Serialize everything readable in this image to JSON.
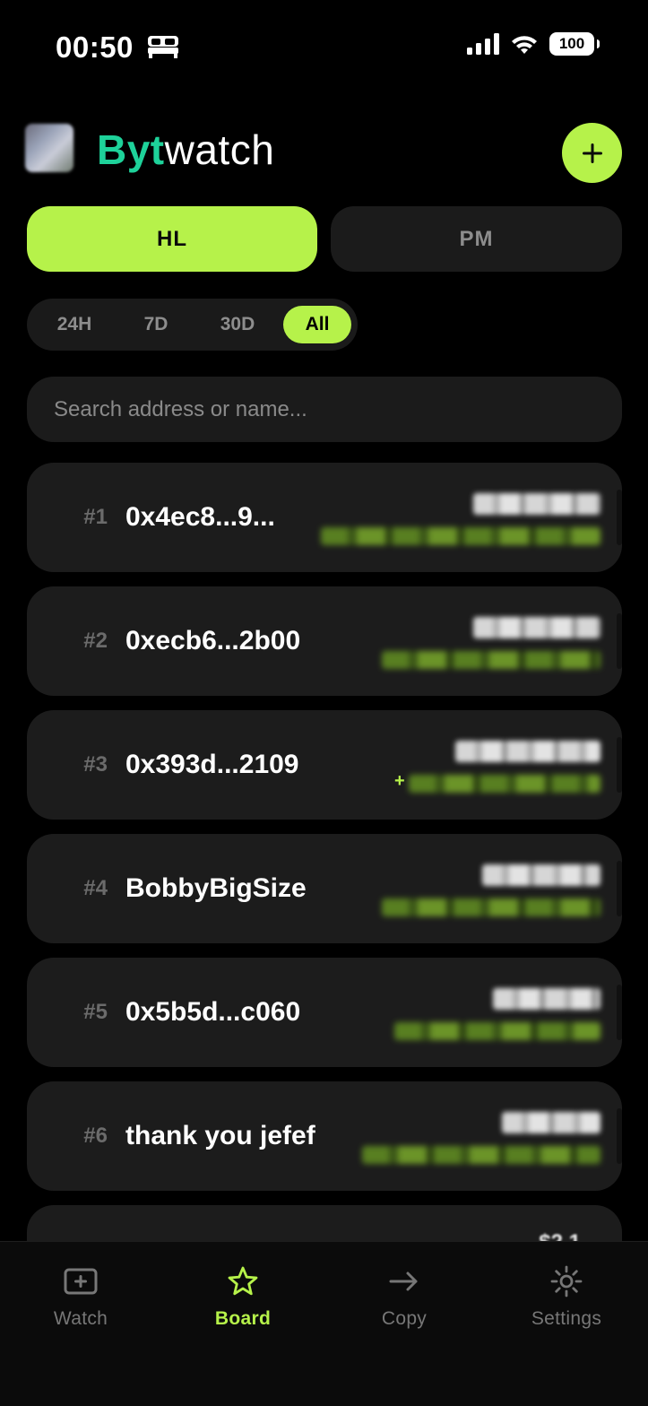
{
  "status_bar": {
    "time": "00:50",
    "battery": "100"
  },
  "header": {
    "brand_part1": "Byt",
    "brand_part2": "watch",
    "add_label": "+"
  },
  "segments": [
    {
      "label": "HL",
      "selected": true
    },
    {
      "label": "PM",
      "selected": false
    }
  ],
  "ranges": [
    {
      "label": "24H"
    },
    {
      "label": "7D"
    },
    {
      "label": "30D"
    },
    {
      "label": "All",
      "selected": true
    }
  ],
  "search": {
    "placeholder": "Search address or name..."
  },
  "leaderboard": [
    {
      "rank": "#1",
      "name": "0x4ec8...9..."
    },
    {
      "rank": "#2",
      "name": "0xecb6...2b00"
    },
    {
      "rank": "#3",
      "name": "0x393d...2109",
      "change_sign": "+"
    },
    {
      "rank": "#4",
      "name": "BobbyBigSize"
    },
    {
      "rank": "#5",
      "name": "0x5b5d...c060"
    },
    {
      "rank": "#6",
      "name": "thank you jefef"
    },
    {
      "rank": "",
      "name": "",
      "value_peek": "$2.1"
    }
  ],
  "tabbar": [
    {
      "label": "Watch",
      "icon": "plus-square-icon",
      "active": false
    },
    {
      "label": "Board",
      "icon": "star-icon",
      "active": true
    },
    {
      "label": "Copy",
      "icon": "arrow-right-icon",
      "active": false
    },
    {
      "label": "Settings",
      "icon": "gear-icon",
      "active": false
    }
  ],
  "colors": {
    "accent": "#b6f24a",
    "brand": "#1ed29a",
    "background": "#000000",
    "card": "#1c1c1c"
  }
}
